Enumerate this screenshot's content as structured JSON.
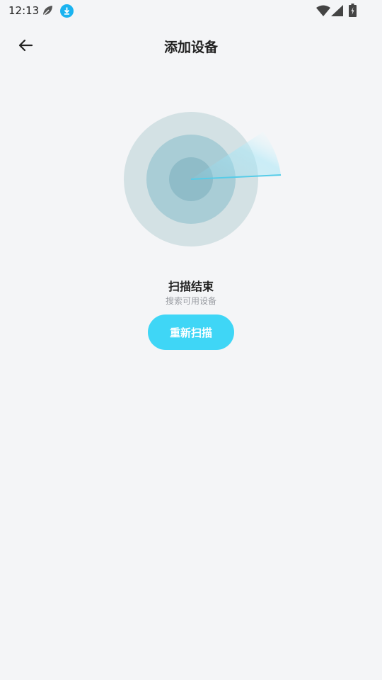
{
  "status_bar": {
    "time": "12:13",
    "icons": [
      "leaf-icon",
      "download-icon",
      "wifi-icon",
      "signal-icon",
      "battery-icon"
    ]
  },
  "header": {
    "back_icon": "arrow-left-icon",
    "title": "添加设备"
  },
  "scan": {
    "status_title": "扫描结束",
    "status_subtitle": "搜索可用设备",
    "rescan_label": "重新扫描"
  },
  "colors": {
    "background": "#f4f5f7",
    "accent": "#3fd6f6",
    "radar_outer": "#d3e1e4",
    "radar_middle": "#a9cdd6",
    "radar_inner": "#8fbcc8"
  }
}
